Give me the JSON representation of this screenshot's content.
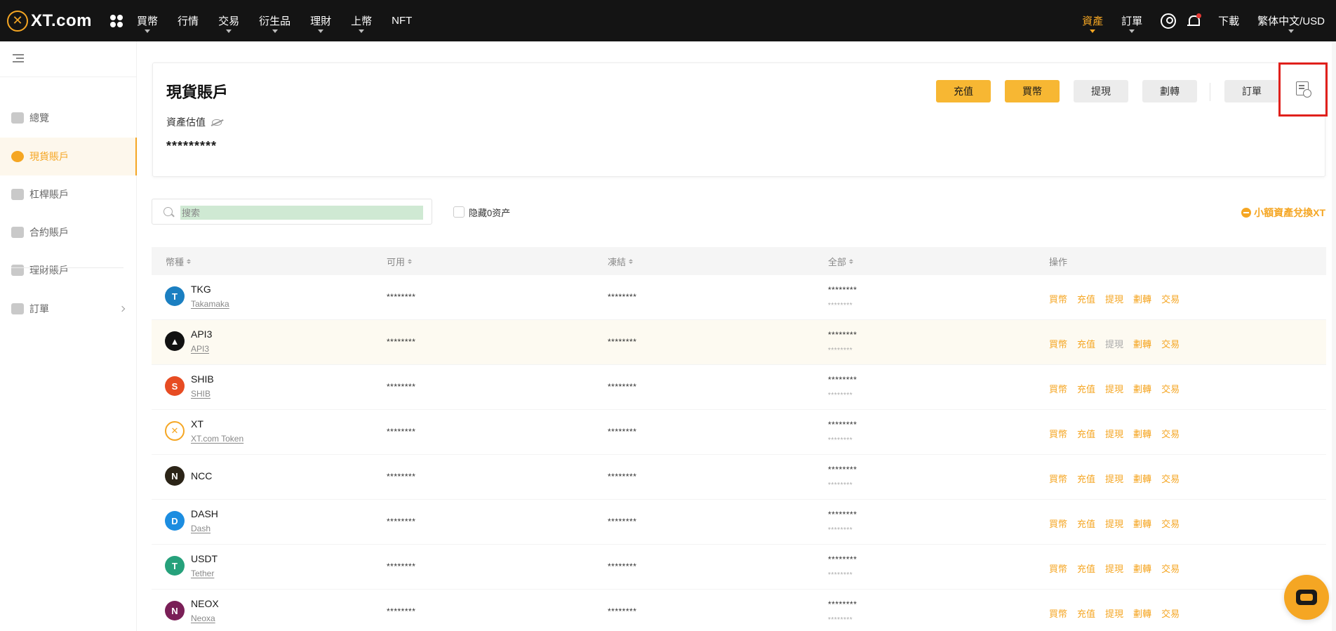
{
  "brand": {
    "logo_text": "XT.com",
    "accent": "#f5a623"
  },
  "nav": {
    "left": [
      {
        "label": "買幣",
        "dropdown": true
      },
      {
        "label": "行情",
        "dropdown": false
      },
      {
        "label": "交易",
        "dropdown": true
      },
      {
        "label": "衍生品",
        "dropdown": true
      },
      {
        "label": "理財",
        "dropdown": true
      },
      {
        "label": "上幣",
        "dropdown": true
      },
      {
        "label": "NFT",
        "dropdown": false
      }
    ],
    "assets": "資產",
    "orders": "訂單",
    "download": "下載",
    "language": "繁体中文/USD"
  },
  "sidebar": {
    "items": [
      {
        "label": "總覽",
        "icon": "overview-icon",
        "active": false
      },
      {
        "label": "現貨賬戶",
        "icon": "spot-pie-icon",
        "active": true
      },
      {
        "label": "杠桿賬戶",
        "icon": "margin-icon",
        "active": false
      },
      {
        "label": "合約賬戶",
        "icon": "futures-icon",
        "active": false
      },
      {
        "label": "理財賬戶",
        "icon": "earn-icon",
        "active": false
      }
    ],
    "orders_label": "訂單"
  },
  "account": {
    "title": "現貨賬戶",
    "estimate_label": "資產估值",
    "estimate_value": "*********",
    "buttons": {
      "deposit": "充值",
      "buy": "買幣",
      "withdraw": "提現",
      "transfer": "劃轉",
      "orders": "訂單"
    }
  },
  "filters": {
    "search_placeholder": "搜索",
    "hide_zero_label": "隐藏0资产",
    "convert_label": "小額資產兌換XT"
  },
  "table": {
    "headers": {
      "coin": "幣種",
      "available": "可用",
      "frozen": "凍結",
      "total": "全部",
      "actions": "操作"
    },
    "action_labels": [
      "買幣",
      "充值",
      "提現",
      "劃轉",
      "交易"
    ],
    "rows": [
      {
        "symbol": "TKG",
        "name": "Takamaka",
        "available": "********",
        "frozen": "********",
        "total": "********",
        "total_sub": "********",
        "logo_color": "#1b7fc1",
        "logo_char": "T",
        "withdraw_disabled": false,
        "hover": false
      },
      {
        "symbol": "API3",
        "name": "API3",
        "available": "********",
        "frozen": "********",
        "total": "********",
        "total_sub": "********",
        "logo_color": "#111111",
        "logo_char": "▲",
        "withdraw_disabled": true,
        "hover": true
      },
      {
        "symbol": "SHIB",
        "name": "SHIB",
        "available": "********",
        "frozen": "********",
        "total": "********",
        "total_sub": "********",
        "logo_color": "#e74c23",
        "logo_char": "S",
        "withdraw_disabled": false,
        "hover": false
      },
      {
        "symbol": "XT",
        "name": "XT.com Token",
        "available": "********",
        "frozen": "********",
        "total": "********",
        "total_sub": "********",
        "logo_color": "#ffffff",
        "logo_char": "✕",
        "withdraw_disabled": false,
        "hover": false
      },
      {
        "symbol": "NCC",
        "name": "",
        "available": "********",
        "frozen": "********",
        "total": "********",
        "total_sub": "********",
        "logo_color": "#2b2417",
        "logo_char": "N",
        "withdraw_disabled": false,
        "hover": false
      },
      {
        "symbol": "DASH",
        "name": "Dash",
        "available": "********",
        "frozen": "********",
        "total": "********",
        "total_sub": "********",
        "logo_color": "#1c8de0",
        "logo_char": "D",
        "withdraw_disabled": false,
        "hover": false
      },
      {
        "symbol": "USDT",
        "name": "Tether",
        "available": "********",
        "frozen": "********",
        "total": "********",
        "total_sub": "********",
        "logo_color": "#26a17b",
        "logo_char": "T",
        "withdraw_disabled": false,
        "hover": false
      },
      {
        "symbol": "NEOX",
        "name": "Neoxa",
        "available": "********",
        "frozen": "********",
        "total": "********",
        "total_sub": "********",
        "logo_color": "#7a1f57",
        "logo_char": "N",
        "withdraw_disabled": false,
        "hover": false
      }
    ]
  }
}
